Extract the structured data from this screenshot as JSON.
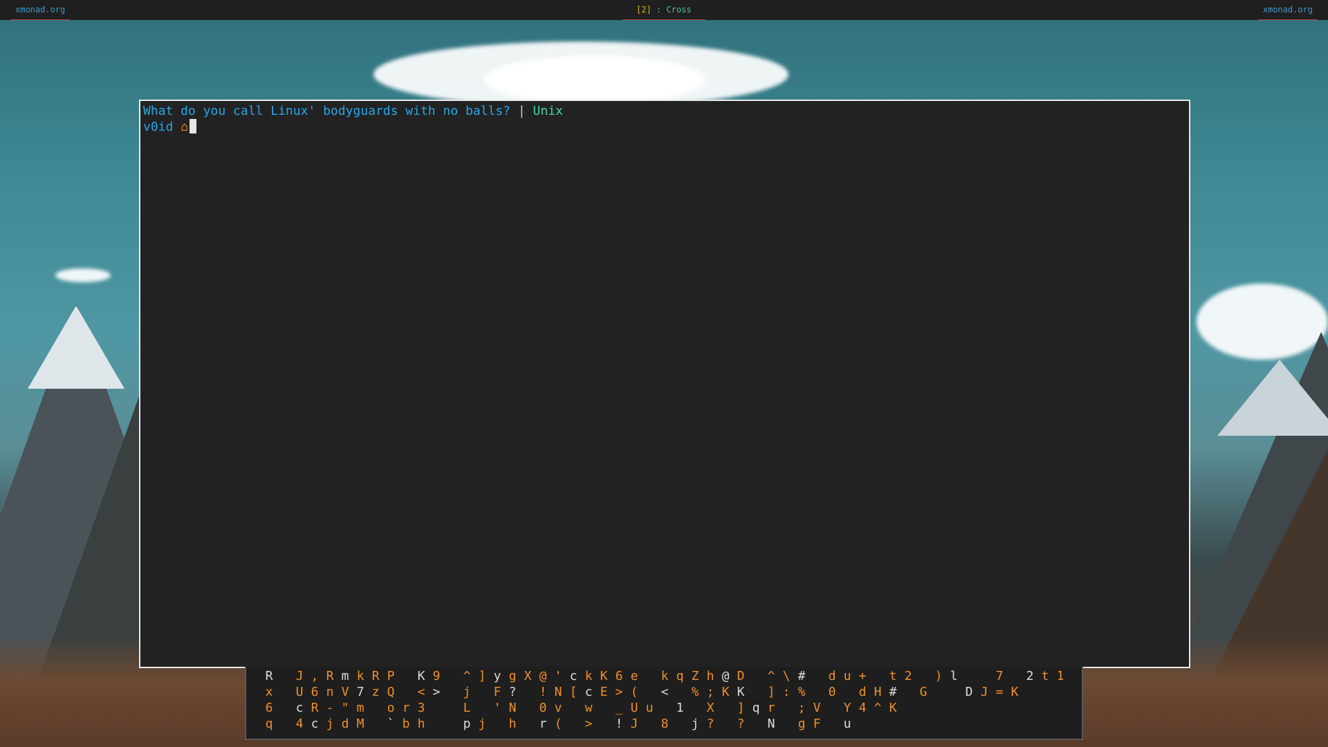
{
  "topbar": {
    "left_link": "xmonad.org",
    "right_link": "xmonad.org",
    "workspace_number": "[2]",
    "workspace_sep": " : ",
    "workspace_name": "Cross"
  },
  "terminal": {
    "joke": "What do you call Linux' bodyguards with no balls?",
    "pipe": " | ",
    "answer": "Unix",
    "prompt_name": "v0id ",
    "prompt_icon": "home-icon",
    "prompt_glyph": "⌂"
  },
  "matrix": {
    "rows": [
      "R  J , R m k R P  K 9  ^ ] y g X @ ' c k K 6 e  k q Z h @ D  ^ \\ #  d u +  t 2  ) l   7  2 t 1",
      "x  U 6 n V 7 z Q  < >  j  F ?  ! N [ c E > (  <  % ; K K  ] : %  0  d H #  G   D J = K",
      "6  c R - \" m  o r 3   L  ' N  0 v  w  _ U u  1  X  ] q r  ; V  Y 4 ^ K",
      "q  4 c j d M  ` b h   p j  h  r (  >  ! J  8  j ?  ?  N  g F  u"
    ],
    "colors": {
      "orange": "#f0902a",
      "white": "#dcdcdc"
    }
  },
  "colors": {
    "bar_bg": "#1f1f1f",
    "link": "#3c98c9",
    "underline": "#c0463a",
    "terminal_bg": "#222222",
    "terminal_border": "#eaeaea",
    "joke_text": "#27a7e8",
    "answer_text": "#3ed6a8"
  }
}
